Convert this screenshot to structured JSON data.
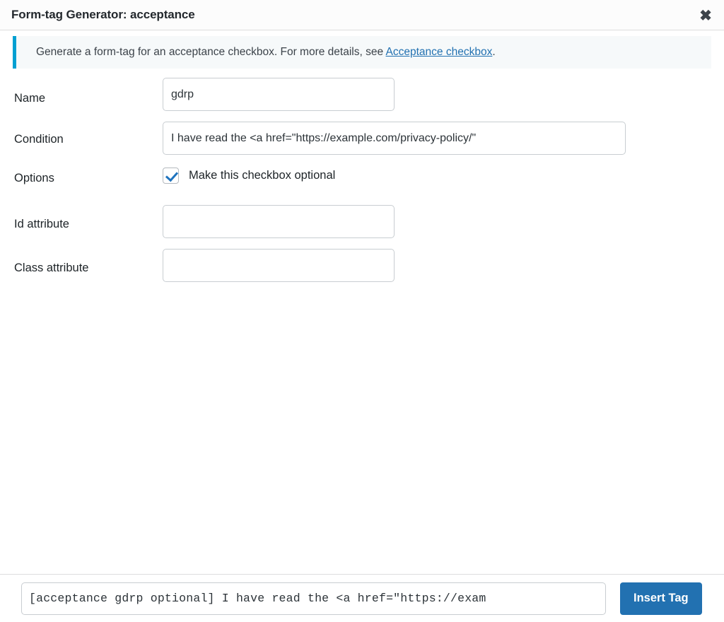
{
  "dialog": {
    "title": "Form-tag Generator: acceptance",
    "close_icon": "close-x-icon",
    "close_label": "✖"
  },
  "notice": {
    "text_before": "Generate a form-tag for an acceptance checkbox. For more details, see ",
    "link_label": "Acceptance checkbox",
    "text_after": ".",
    "accent_color": "#00a0d2",
    "background_color": "#f6f9fa"
  },
  "fields": {
    "name": {
      "label": "Name",
      "value": "gdrp",
      "placeholder": ""
    },
    "condition": {
      "label": "Condition",
      "value": "I have read the <a href=\"https://example.com/privacy-policy/\"",
      "placeholder": ""
    },
    "options": {
      "label": "Options",
      "checkbox_label": "Make this checkbox optional",
      "checked": true,
      "check_color": "#1e73be"
    },
    "id_attribute": {
      "label": "Id attribute",
      "value": "",
      "placeholder": ""
    },
    "class_attribute": {
      "label": "Class attribute",
      "value": "",
      "placeholder": ""
    }
  },
  "footer": {
    "tag_value": "[acceptance gdrp optional] I have read the <a href=\"https://exam",
    "tag_placeholder": "",
    "insert_label": "Insert Tag",
    "button_color": "#2271b1"
  }
}
